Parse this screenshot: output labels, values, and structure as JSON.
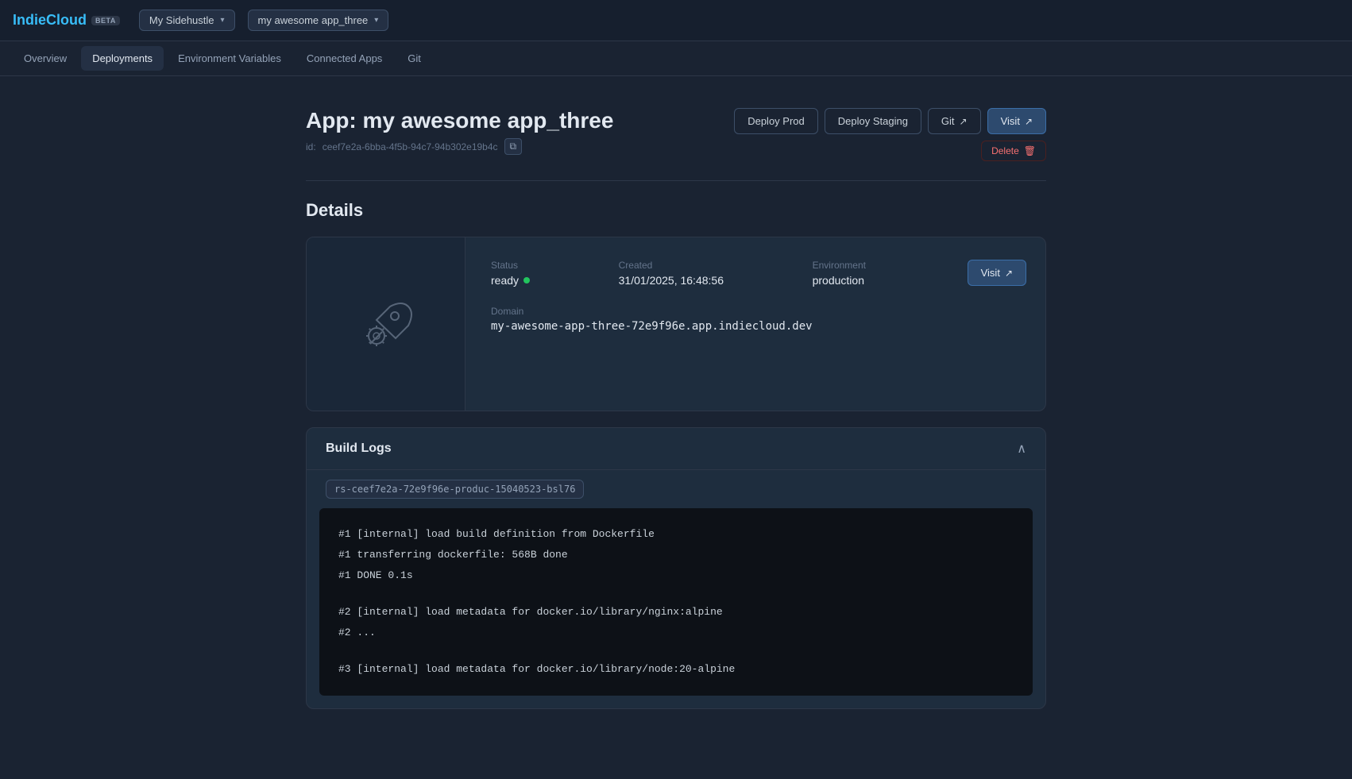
{
  "brand": {
    "name_part1": "Indie",
    "name_part2": "Cloud",
    "beta": "BETA"
  },
  "topnav": {
    "workspace_label": "My Sidehustle",
    "app_label": "my awesome app_three"
  },
  "subnav": {
    "items": [
      {
        "label": "Overview",
        "active": false
      },
      {
        "label": "Deployments",
        "active": true
      },
      {
        "label": "Environment Variables",
        "active": false
      },
      {
        "label": "Connected Apps",
        "active": false
      },
      {
        "label": "Git",
        "active": false
      }
    ]
  },
  "app_header": {
    "title": "App: my awesome app_three",
    "id_label": "id:",
    "id_value": "ceef7e2a-6bba-4f5b-94c7-94b302e19b4c",
    "copy_icon": "⧉",
    "btn_deploy_prod": "Deploy Prod",
    "btn_deploy_staging": "Deploy Staging",
    "btn_git": "Git",
    "btn_git_icon": "↗",
    "btn_visit": "Visit",
    "btn_visit_icon": "↗",
    "btn_delete": "Delete",
    "btn_delete_icon": "🗑"
  },
  "details": {
    "section_title": "Details",
    "status_label": "Status",
    "status_value": "ready",
    "created_label": "Created",
    "created_value": "31/01/2025, 16:48:56",
    "environment_label": "Environment",
    "environment_value": "production",
    "domain_label": "Domain",
    "domain_value": "my-awesome-app-three-72e9f96e.app.indiecloud.dev",
    "visit_btn": "Visit",
    "visit_icon": "↗"
  },
  "build_logs": {
    "title": "Build Logs",
    "collapse_icon": "∧",
    "tag": "rs-ceef7e2a-72e9f96e-produc-15040523-bsl76",
    "lines": [
      "#1 [internal] load build definition from Dockerfile",
      "#1 transferring dockerfile: 568B done",
      "#1 DONE 0.1s",
      "",
      "#2 [internal] load metadata for docker.io/library/nginx:alpine",
      "#2 ...",
      "",
      "#3 [internal] load metadata for docker.io/library/node:20-alpine"
    ]
  }
}
